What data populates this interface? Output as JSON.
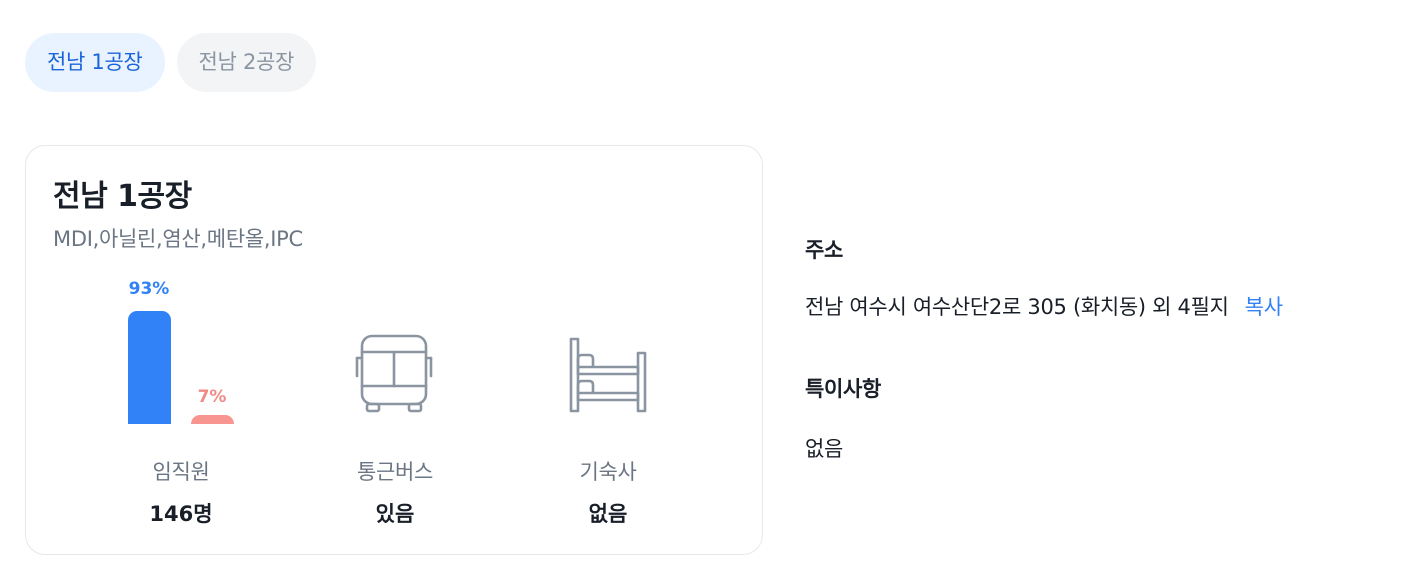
{
  "tabs": [
    {
      "label": "전남 1공장",
      "active": true
    },
    {
      "label": "전남 2공장",
      "active": false
    }
  ],
  "factory": {
    "name": "전남 1공장",
    "products": "MDI,아닐린,염산,메탄올,IPC"
  },
  "employee_chart": {
    "primary_percent": 93,
    "secondary_percent": 7,
    "primary_label": "93%",
    "secondary_label": "7%"
  },
  "stats": {
    "employees": {
      "label": "임직원",
      "value": "146명"
    },
    "bus": {
      "label": "통근버스",
      "value": "있음",
      "icon": "bus-icon"
    },
    "dorm": {
      "label": "기숙사",
      "value": "없음",
      "icon": "bunk-bed-icon"
    }
  },
  "info": {
    "address_label": "주소",
    "address": "전남 여수시 여수산단2로 305 (화치동) 외 4필지",
    "copy_label": "복사",
    "notes_label": "특이사항",
    "notes": "없음"
  },
  "colors": {
    "primary": "#3182f6",
    "secondary": "#f99591",
    "active_tab_bg": "#e8f3ff",
    "inactive_tab_bg": "#f2f4f6"
  }
}
